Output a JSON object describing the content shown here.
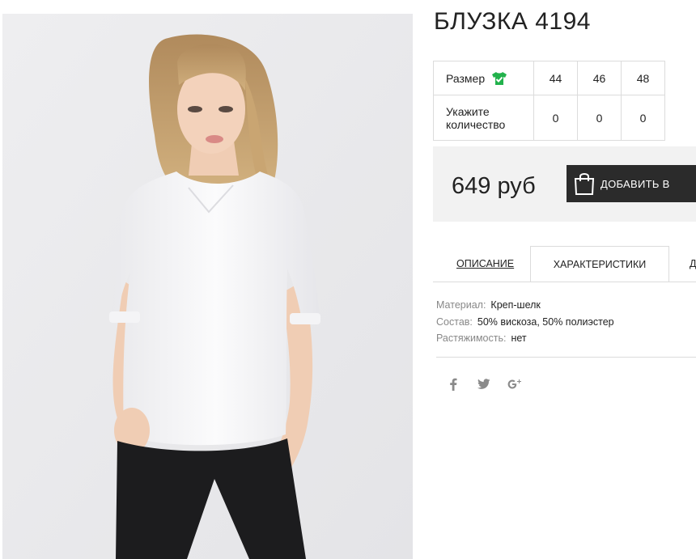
{
  "product": {
    "title": "БЛУЗКА 4194",
    "image_icon": "product-photo-model-white-blouse"
  },
  "sizes": {
    "label": "Размер",
    "icon": "shirt-check-icon",
    "icon_color": "#22b24c",
    "values": [
      "44",
      "46",
      "48"
    ],
    "quantity_label": "Укажите количество",
    "quantities": [
      "0",
      "0",
      "0"
    ]
  },
  "purchase": {
    "price": "649 руб",
    "add_to_cart_label": "ДОБАВИТЬ В",
    "add_to_cart_icon": "shopping-bag-icon",
    "button_color": "#2b2b2b"
  },
  "tabs": [
    {
      "label": "ОПИСАНИЕ",
      "active": false
    },
    {
      "label": "ХАРАКТЕРИСТИКИ",
      "active": true
    },
    {
      "label": "Д",
      "active": false
    }
  ],
  "specs": [
    {
      "key": "Материал:",
      "value": "Креп-шелк"
    },
    {
      "key": "Состав:",
      "value": "50% вискоза, 50% полиэстер"
    },
    {
      "key": "Растяжимость:",
      "value": "нет"
    }
  ],
  "social": [
    {
      "name": "facebook-icon",
      "glyph": "f"
    },
    {
      "name": "twitter-icon",
      "glyph": "t"
    },
    {
      "name": "google-plus-icon",
      "glyph": "g+"
    }
  ]
}
